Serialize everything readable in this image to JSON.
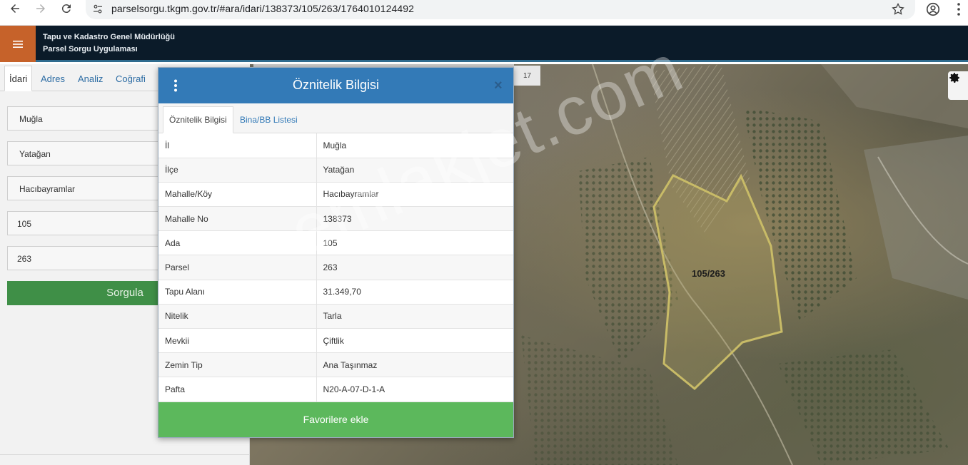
{
  "browser": {
    "url": "parselsorgu.tkgm.gov.tr/#ara/idari/138373/105/263/1764010124492"
  },
  "header": {
    "title_line1": "Tapu ve Kadastro Genel Müdürlüğü",
    "title_line2": "Parsel Sorgu Uygulaması"
  },
  "left_panel": {
    "tabs": [
      {
        "label": "İdari"
      },
      {
        "label": "Adres"
      },
      {
        "label": "Analiz"
      },
      {
        "label": "Coğrafi"
      }
    ],
    "fields": [
      {
        "value": "Muğla"
      },
      {
        "value": "Yatağan"
      },
      {
        "value": "Hacıbayramlar"
      },
      {
        "value": "105"
      },
      {
        "value": "263"
      }
    ],
    "query_button": "Sorgula"
  },
  "map": {
    "scale_label": "17",
    "parcel_label": "105/263",
    "watermark": "emlakjet.com",
    "parcel_outline_color": "#c8bb67"
  },
  "modal": {
    "title": "Öznitelik Bilgisi",
    "close": "×",
    "tabs": [
      {
        "label": "Öznitelik Bilgisi"
      },
      {
        "label": "Bina/BB Listesi"
      }
    ],
    "rows": [
      {
        "key": "İl",
        "value": "Muğla"
      },
      {
        "key": "İlçe",
        "value": "Yatağan"
      },
      {
        "key": "Mahalle/Köy",
        "value": "Hacıbayramlar"
      },
      {
        "key": "Mahalle No",
        "value": "138373"
      },
      {
        "key": "Ada",
        "value": "105"
      },
      {
        "key": "Parsel",
        "value": "263"
      },
      {
        "key": "Tapu Alanı",
        "value": "31.349,70"
      },
      {
        "key": "Nitelik",
        "value": "Tarla"
      },
      {
        "key": "Mevkii",
        "value": "Çiftlik"
      },
      {
        "key": "Zemin Tip",
        "value": "Ana Taşınmaz"
      },
      {
        "key": "Pafta",
        "value": "N20-A-07-D-1-A"
      }
    ],
    "footer_button": "Favorilere ekle"
  },
  "colors": {
    "header_bg": "#0b1b29",
    "menu_accent": "#c6622a",
    "modal_header": "#337ab7",
    "query_button": "#3f8f47",
    "favorite_button": "#5cb85c"
  }
}
